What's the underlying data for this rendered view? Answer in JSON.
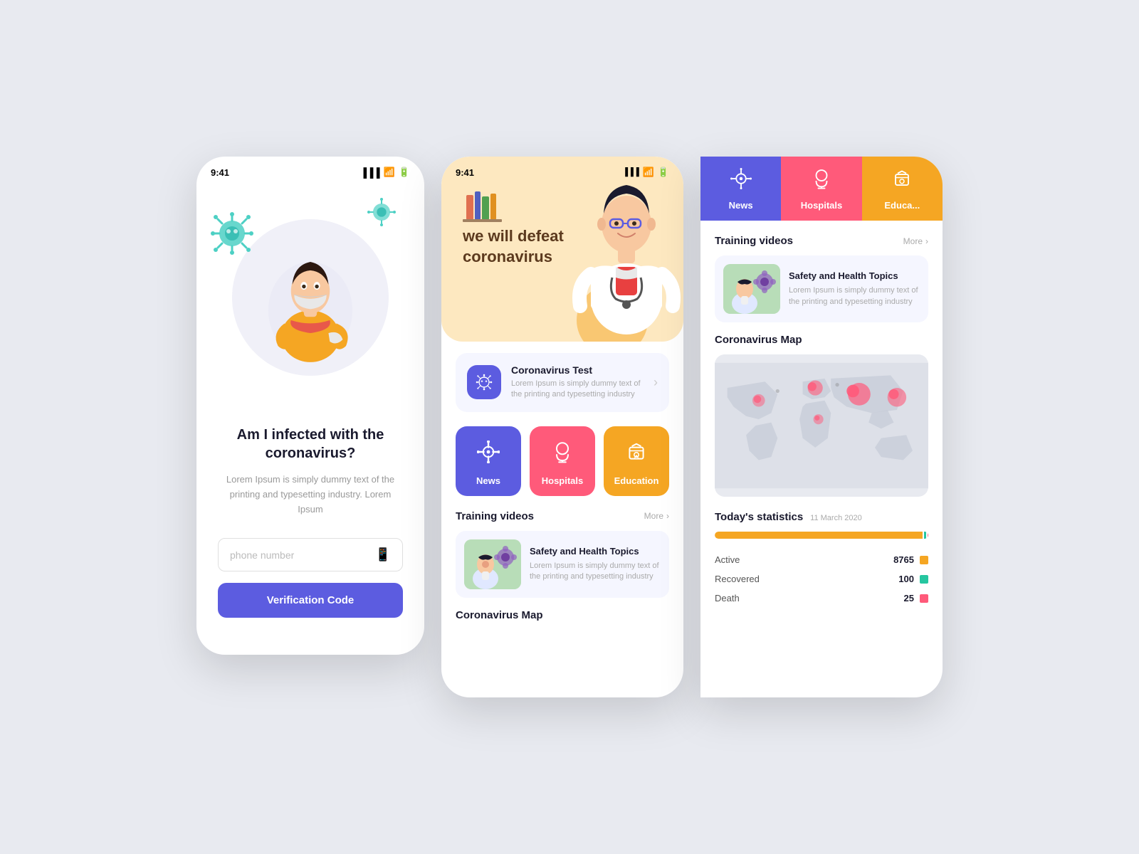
{
  "screen1": {
    "status_time": "9:41",
    "title": "Am I infected with the coronavirus?",
    "description": "Lorem Ipsum is simply dummy text of the printing and typesetting industry. Lorem Ipsum",
    "phone_placeholder": "phone number",
    "verify_btn": "Verification Code"
  },
  "screen2": {
    "status_time": "9:41",
    "tagline": "we will defeat\ncoronavirus",
    "test_card": {
      "title": "Coronavirus Test",
      "description": "Lorem Ipsum is simply dummy text of the printing and typesetting industry"
    },
    "categories": [
      {
        "label": "News",
        "color": "blue"
      },
      {
        "label": "Hospitals",
        "color": "red"
      },
      {
        "label": "Education",
        "color": "orange"
      }
    ],
    "training_section": "Training videos",
    "more_label": "More",
    "video_card": {
      "title": "Safety and Health Topics",
      "description": "Lorem Ipsum is simply dummy text of the printing and typesetting industry"
    },
    "map_section": "Coronavirus Map"
  },
  "screen3": {
    "tabs": [
      {
        "label": "News",
        "color": "blue"
      },
      {
        "label": "Hospitals",
        "color": "red"
      },
      {
        "label": "Educa...",
        "color": "orange"
      }
    ],
    "training_section": "Training videos",
    "more_label": "More",
    "video_card": {
      "title": "Safety and Health Topics",
      "description": "Lorem Ipsum is simply dummy text of the printing and typesetting industry"
    },
    "map_section": "Coronavirus Map",
    "stats_section": "Today's statistics",
    "stats_date": "11 March 2020",
    "stats": [
      {
        "label": "Active",
        "value": "8765",
        "color": "orange"
      },
      {
        "label": "Recovered",
        "value": "100",
        "color": "teal"
      },
      {
        "label": "Death",
        "value": "25",
        "color": "red"
      }
    ]
  },
  "colors": {
    "blue": "#5c5ce0",
    "red": "#ff5a7a",
    "orange": "#f5a623",
    "teal": "#26c6a0",
    "bg": "#e8eaf0",
    "text_dark": "#1a1a2e",
    "text_muted": "#aaa"
  }
}
